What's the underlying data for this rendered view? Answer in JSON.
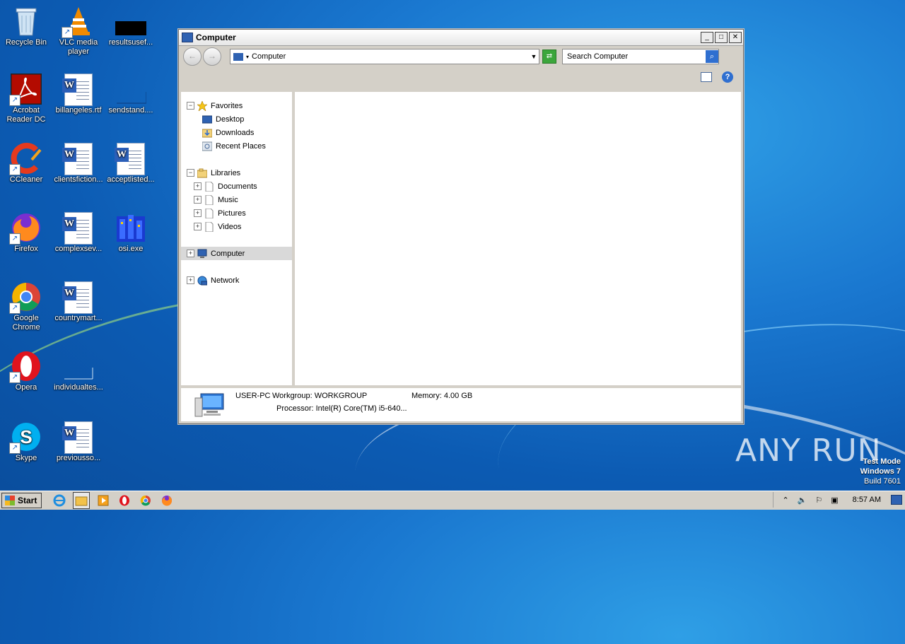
{
  "desktop_icons": [
    {
      "label": "Recycle Bin"
    },
    {
      "label": "VLC media player"
    },
    {
      "label": "resultsusef..."
    },
    {
      "label": "Acrobat Reader DC"
    },
    {
      "label": "billangeles.rtf"
    },
    {
      "label": "sendstand...."
    },
    {
      "label": "CCleaner"
    },
    {
      "label": "clientsfiction..."
    },
    {
      "label": "acceptlisted..."
    },
    {
      "label": "Firefox"
    },
    {
      "label": "complexsev..."
    },
    {
      "label": "osi.exe"
    },
    {
      "label": "Google Chrome"
    },
    {
      "label": "countrymart..."
    },
    {
      "label": "Opera"
    },
    {
      "label": "individualtes..."
    },
    {
      "label": "Skype"
    },
    {
      "label": "previousso..."
    }
  ],
  "window": {
    "title": "Computer",
    "address": "Computer",
    "search_placeholder": "Search Computer",
    "tree": {
      "favorites": "Favorites",
      "desktop": "Desktop",
      "downloads": "Downloads",
      "recent": "Recent Places",
      "libraries": "Libraries",
      "documents": "Documents",
      "music": "Music",
      "pictures": "Pictures",
      "videos": "Videos",
      "computer": "Computer",
      "network": "Network"
    },
    "details": {
      "name": "USER-PC",
      "workgroup": "Workgroup: WORKGROUP",
      "memory": "Memory: 4.00 GB",
      "processor": "Processor: Intel(R) Core(TM) i5-640..."
    }
  },
  "taskbar": {
    "start_label": "Start",
    "clock": "8:57 AM"
  },
  "watermark": {
    "line1": "Test Mode",
    "line2": "Windows 7",
    "line3": "Build 7601",
    "brand": "ANY RUN"
  },
  "colors": {
    "desktop_blue": "#1a78d0",
    "window_gray": "#d4d0c8",
    "selection": "#d9d9d9"
  }
}
